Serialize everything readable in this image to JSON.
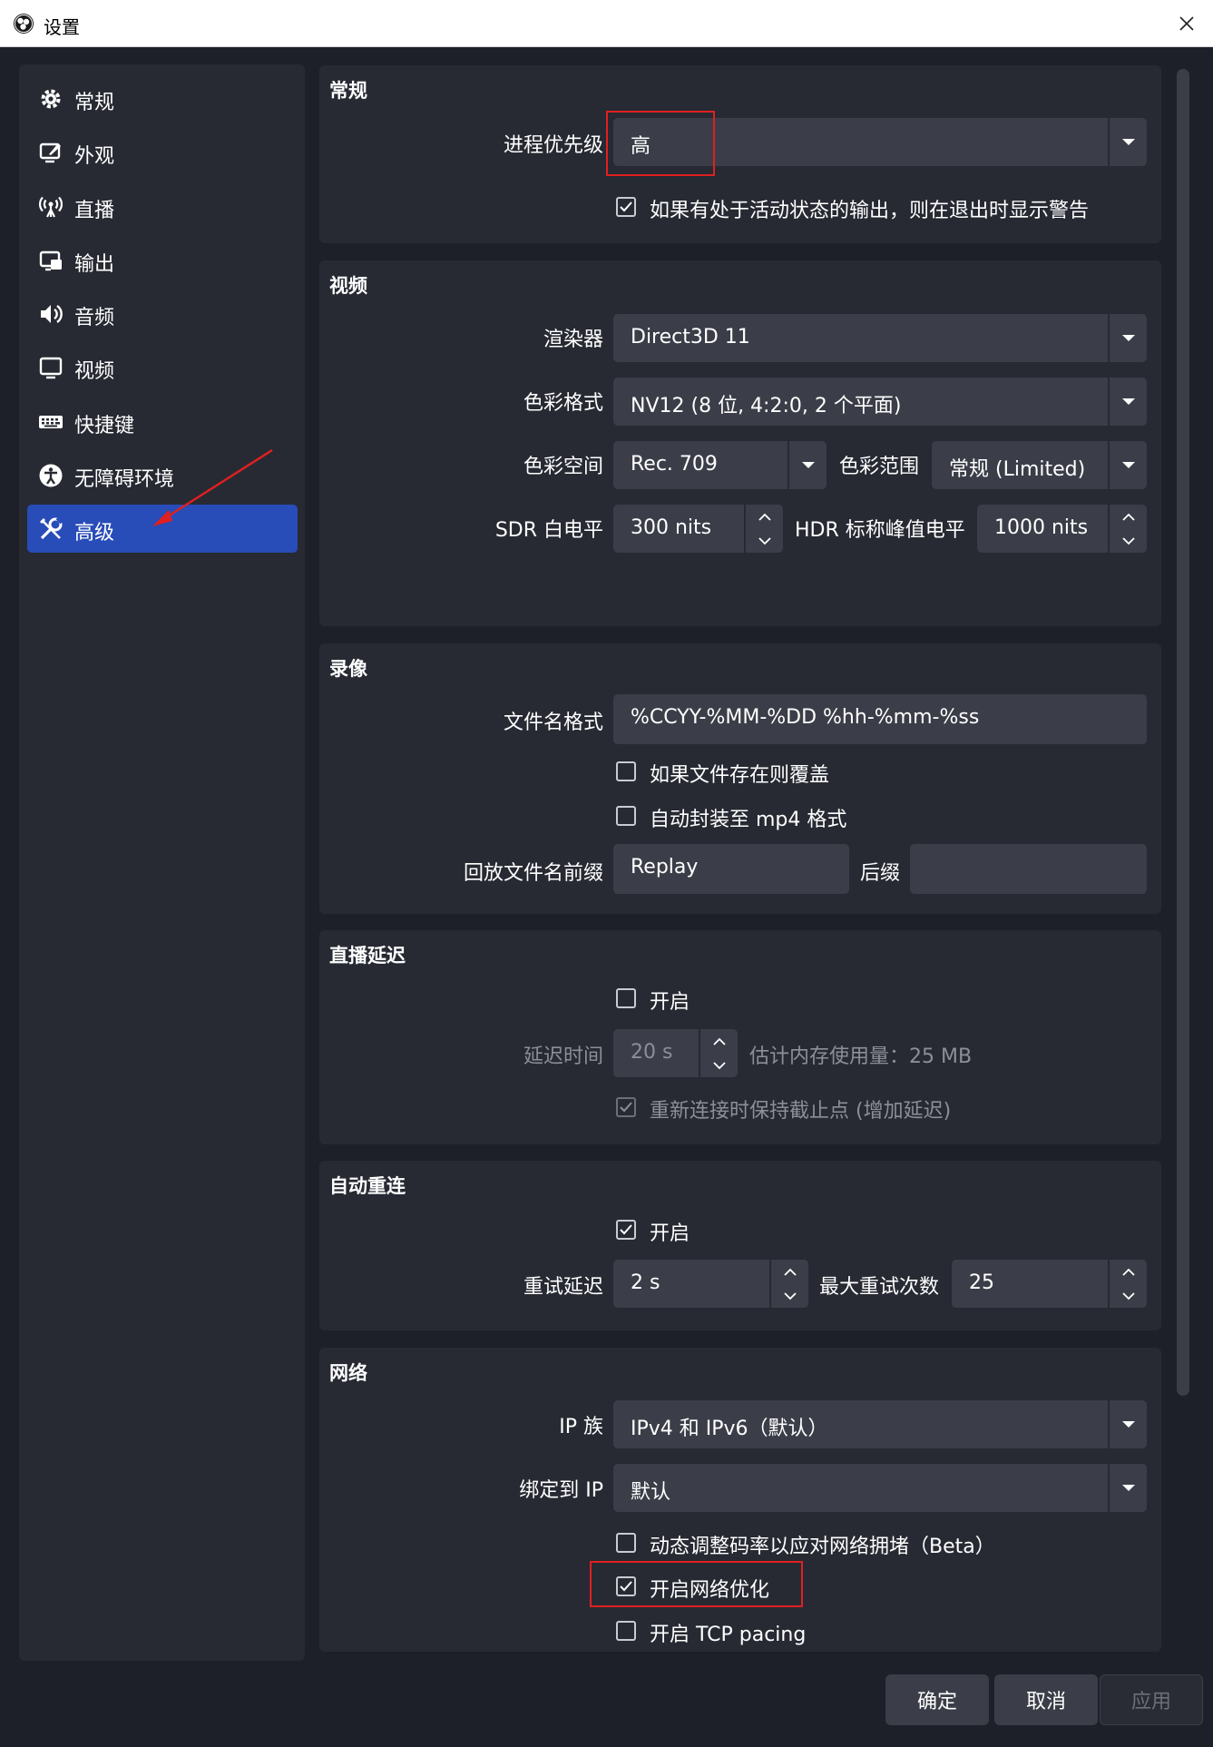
{
  "window": {
    "title": "设置"
  },
  "sidebar": {
    "items": [
      {
        "label": "常规"
      },
      {
        "label": "外观"
      },
      {
        "label": "直播"
      },
      {
        "label": "输出"
      },
      {
        "label": "音频"
      },
      {
        "label": "视频"
      },
      {
        "label": "快捷键"
      },
      {
        "label": "无障碍环境"
      },
      {
        "label": "高级"
      }
    ],
    "active_index": 8
  },
  "general": {
    "title": "常规",
    "priority_label": "进程优先级",
    "priority_value": "高",
    "warn_on_exit_label": "如果有处于活动状态的输出，则在退出时显示警告",
    "warn_on_exit_checked": true
  },
  "video": {
    "title": "视频",
    "renderer_label": "渲染器",
    "renderer_value": "Direct3D 11",
    "color_format_label": "色彩格式",
    "color_format_value": "NV12 (8 位, 4:2:0, 2 个平面)",
    "color_space_label": "色彩空间",
    "color_space_value": "Rec. 709",
    "color_range_label": "色彩范围",
    "color_range_value": "常规 (Limited)",
    "sdr_label": "SDR 白电平",
    "sdr_value": "300 nits",
    "hdr_label": "HDR 标称峰值电平",
    "hdr_value": "1000 nits"
  },
  "recording": {
    "title": "录像",
    "filename_label": "文件名格式",
    "filename_value": "%CCYY-%MM-%DD %hh-%mm-%ss",
    "overwrite_label": "如果文件存在则覆盖",
    "overwrite_checked": false,
    "remux_label": "自动封装至 mp4 格式",
    "remux_checked": false,
    "replay_prefix_label": "回放文件名前缀",
    "replay_prefix_value": "Replay",
    "replay_suffix_label": "后缀",
    "replay_suffix_value": ""
  },
  "stream_delay": {
    "title": "直播延迟",
    "enable_label": "开启",
    "enable_checked": false,
    "duration_label": "延迟时间",
    "duration_value": "20 s",
    "memory_label": "估计内存使用量：25 MB",
    "preserve_label": "重新连接时保持截止点 (增加延迟)",
    "preserve_checked": true
  },
  "reconnect": {
    "title": "自动重连",
    "enable_label": "开启",
    "enable_checked": true,
    "retry_delay_label": "重试延迟",
    "retry_delay_value": "2 s",
    "max_retries_label": "最大重试次数",
    "max_retries_value": "25"
  },
  "network": {
    "title": "网络",
    "ip_family_label": "IP 族",
    "ip_family_value": "IPv4 和 IPv6（默认）",
    "bind_ip_label": "绑定到 IP",
    "bind_ip_value": "默认",
    "dynamic_bitrate_label": "动态调整码率以应对网络拥堵（Beta）",
    "dynamic_bitrate_checked": false,
    "optimizations_label": "开启网络优化",
    "optimizations_checked": true,
    "tcp_pacing_label": "开启 TCP pacing",
    "tcp_pacing_checked": false
  },
  "footer": {
    "ok_label": "确定",
    "cancel_label": "取消",
    "apply_label": "应用"
  },
  "colors": {
    "background": "#1e2029",
    "panel": "#272a33",
    "control": "#3b3e48",
    "accent": "#284cb8",
    "annotation": "#e02020"
  },
  "icons": {
    "sidebar": [
      "gear-icon",
      "appearance-icon",
      "broadcast-icon",
      "output-icon",
      "audio-icon",
      "monitor-icon",
      "keyboard-icon",
      "accessibility-icon",
      "tools-icon"
    ]
  }
}
